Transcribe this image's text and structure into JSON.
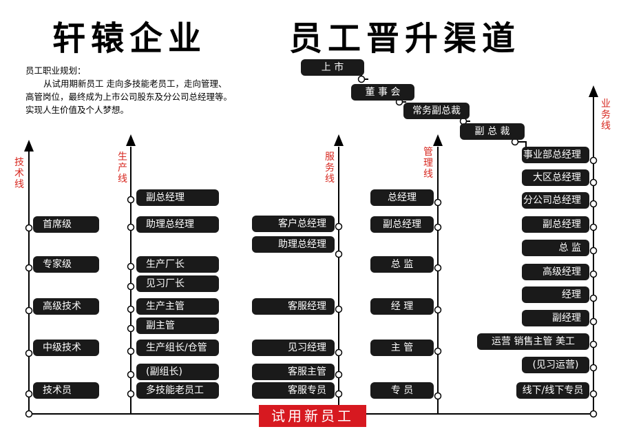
{
  "title": {
    "left": "轩辕企业",
    "right": "员工晋升渠道"
  },
  "description": {
    "heading": "员工职业规划：",
    "line1": "从试用期新员工 走向多技能老员工，走向管理、",
    "line2": "高管岗位，最终成为上市公司股东及分公司总经理等。",
    "line3": "实现人生价值及个人梦想。"
  },
  "axes": {
    "tech": "技术线",
    "production": "生产线",
    "service": "服务线",
    "management": "管理线",
    "business": "业务线"
  },
  "tech_line": [
    "首席级",
    "专家级",
    "高级技术",
    "中级技术",
    "技术员"
  ],
  "production_line": [
    "副总经理",
    "助理总经理",
    "生产厂长",
    "见习厂长",
    "生产主管",
    "副主管",
    "生产组长/仓管",
    "(副组长)",
    "多技能老员工"
  ],
  "service_line": [
    "客户总经理",
    "助理总经理",
    "客服经理",
    "见习经理",
    "客服主管",
    "客服专员"
  ],
  "management_line": [
    "总经理",
    "副总经理",
    "总  监",
    "经  理",
    "主  管",
    "专  员"
  ],
  "top_steps": [
    "上  市",
    "董 事 会",
    "常务副总裁",
    "副 总 裁"
  ],
  "business_line": [
    "事业部总经理",
    "大区总经理",
    "分公司总经理",
    "副总经理",
    "总  监",
    "高级经理",
    "经理",
    "副经理",
    "运营  销售主管 美工",
    "(见习运营)",
    "线下/线下专员"
  ],
  "base": "试用新员工"
}
